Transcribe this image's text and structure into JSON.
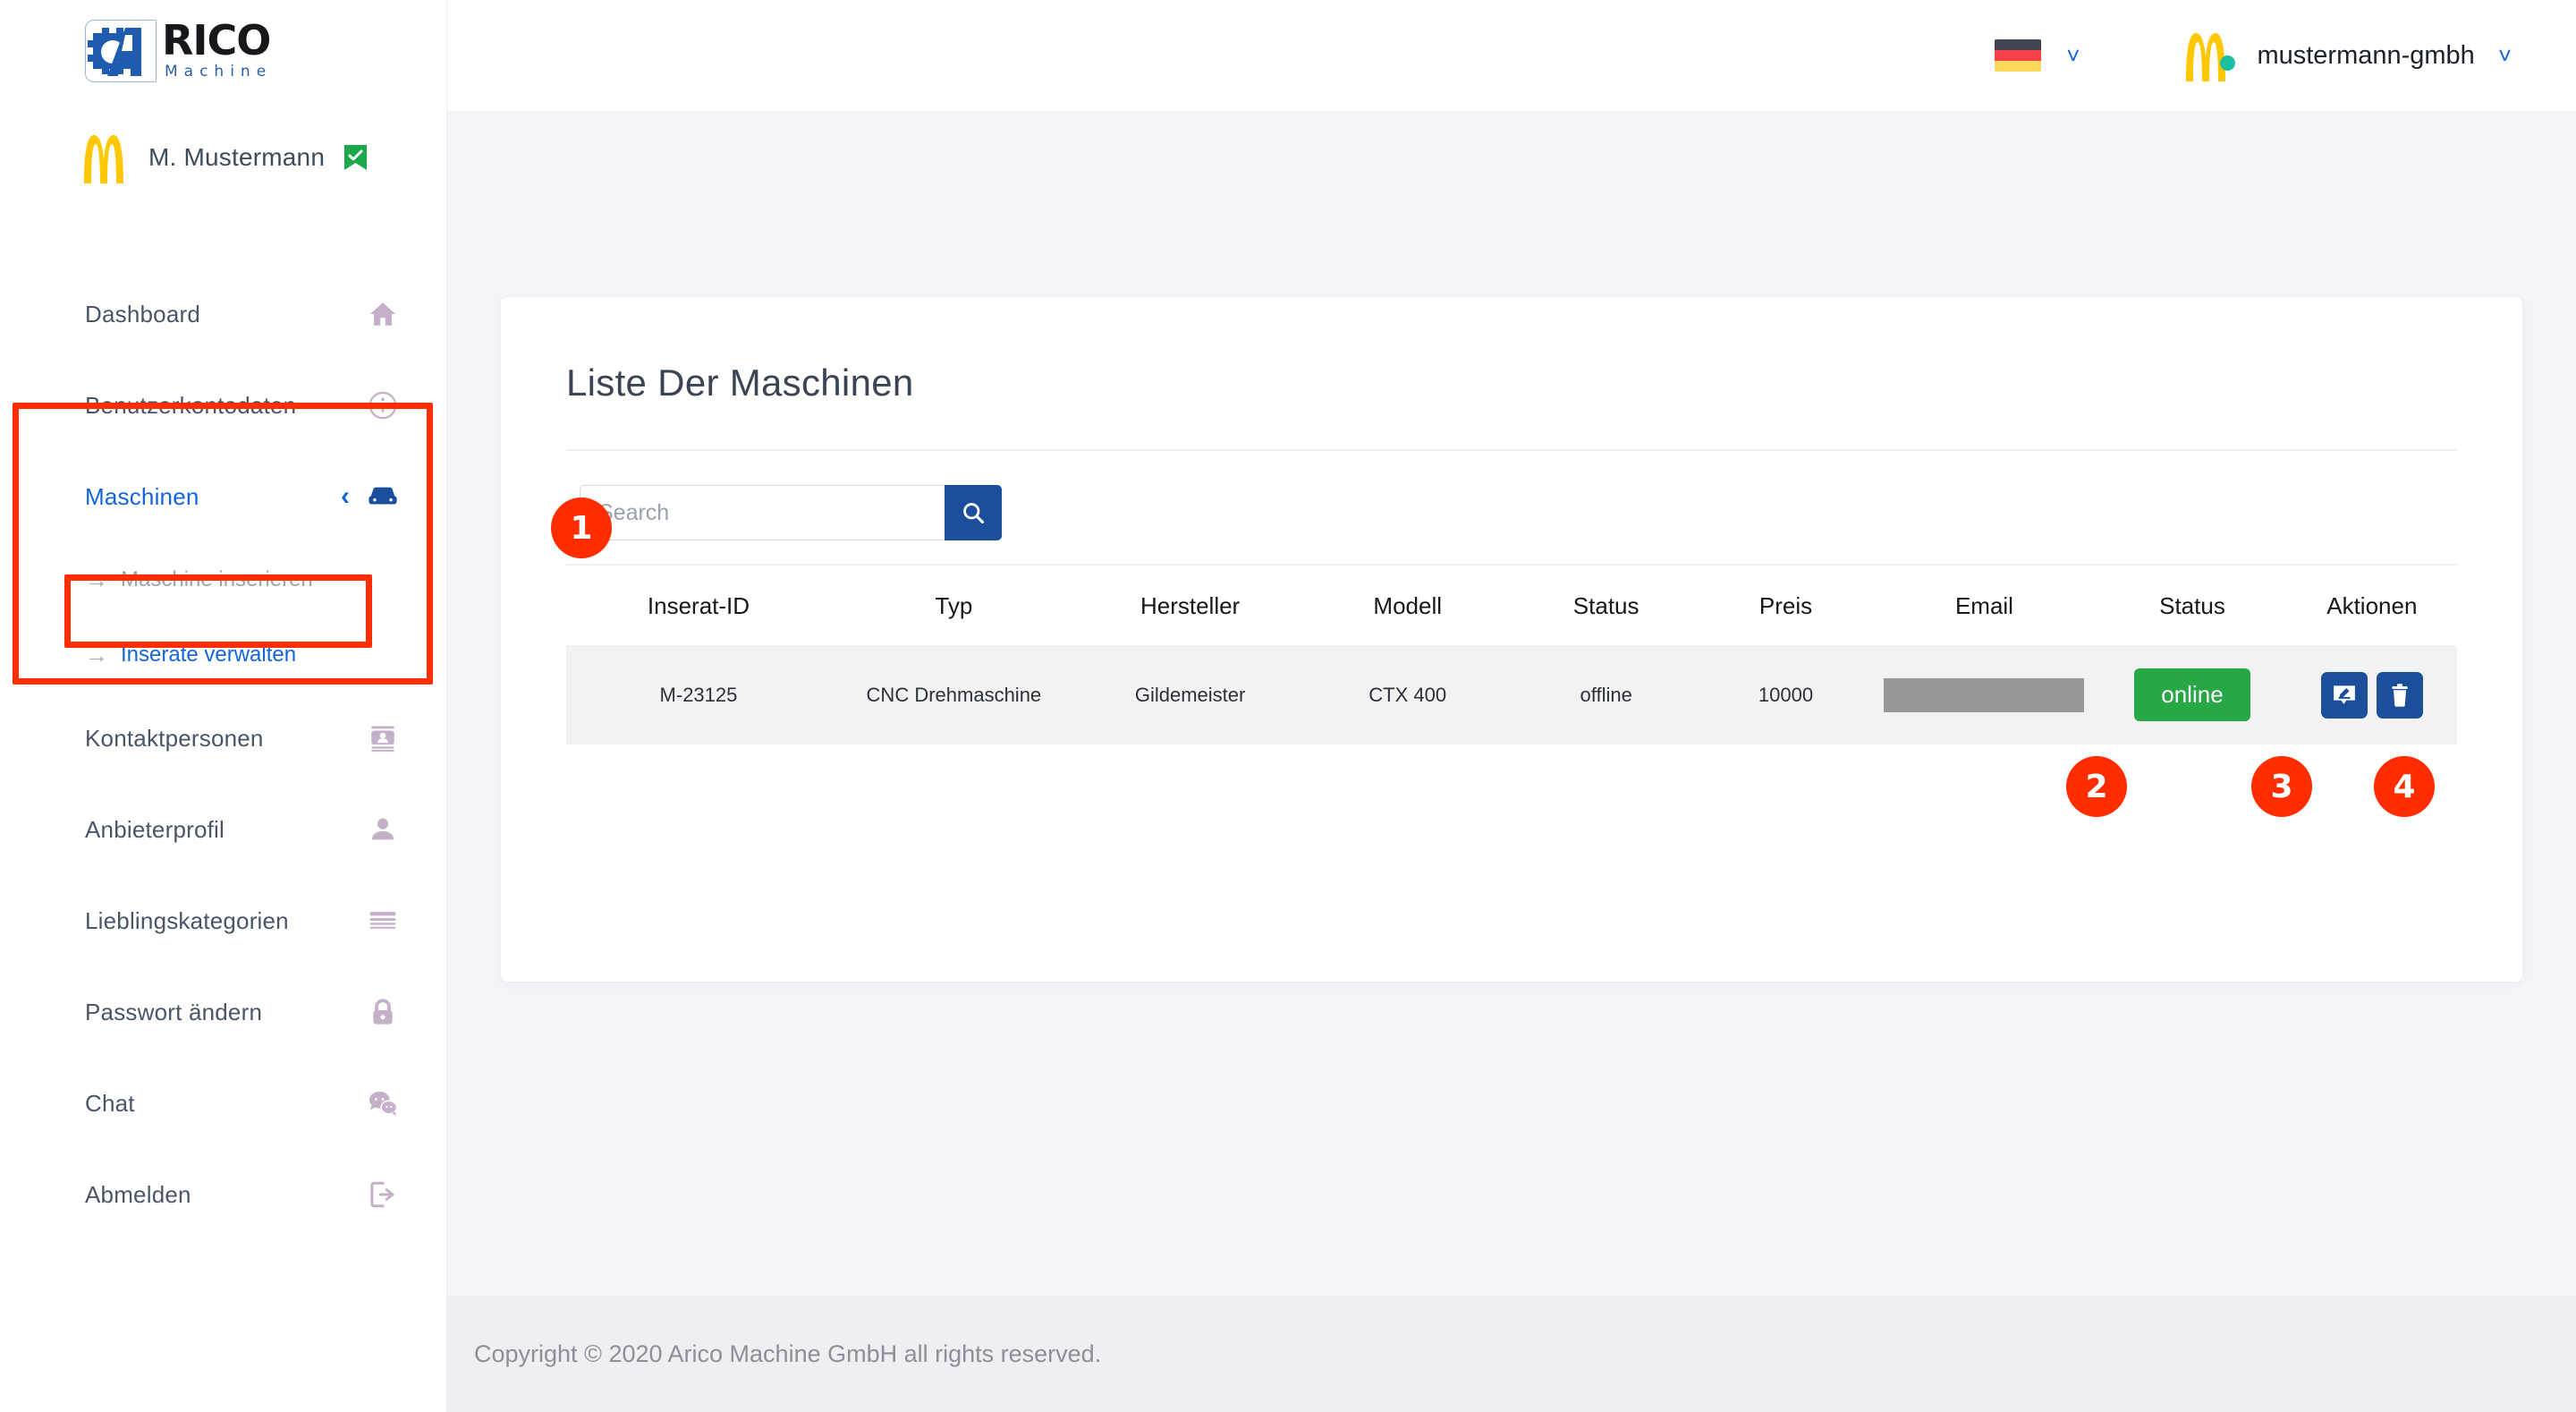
{
  "brand": {
    "logo_primary": "RICO",
    "logo_secondary": "Machine",
    "logo_blue": "#2a5fa8"
  },
  "sidebar": {
    "user": {
      "name": "M. Mustermann",
      "verified_icon": "verified-check-icon"
    },
    "items": [
      {
        "label": "Dashboard",
        "icon": "home-icon",
        "active": false
      },
      {
        "label": "Benutzerkontodaten",
        "icon": "info-circle-icon",
        "active": false
      },
      {
        "label": "Maschinen",
        "icon": "machine-car-icon",
        "active": true,
        "expanded": true
      },
      {
        "label": "Kontaktpersonen",
        "icon": "contact-card-icon",
        "active": false
      },
      {
        "label": "Anbieterprofil",
        "icon": "person-icon",
        "active": false
      },
      {
        "label": "Lieblingskategorien",
        "icon": "list-lines-icon",
        "active": false
      },
      {
        "label": "Passwort ändern",
        "icon": "lock-icon",
        "active": false
      },
      {
        "label": "Chat",
        "icon": "chat-bubbles-icon",
        "active": false
      },
      {
        "label": "Abmelden",
        "icon": "logout-icon",
        "active": false
      }
    ],
    "submenu": [
      {
        "label": "Maschine inserieren",
        "active": false
      },
      {
        "label": "Inserate verwalten",
        "active": true
      }
    ]
  },
  "topbar": {
    "language": {
      "flag": "de-flag-icon",
      "caret": "chevron-down-icon"
    },
    "account": {
      "name": "mustermann-gmbh",
      "caret": "chevron-down-icon",
      "status_dot_color": "#1dbfa3"
    }
  },
  "main": {
    "card_title": "Liste Der Maschinen",
    "search": {
      "placeholder": "Search",
      "value": "",
      "button_icon": "search-icon"
    },
    "table": {
      "headers": [
        "Inserat-ID",
        "Typ",
        "Hersteller",
        "Modell",
        "Status",
        "Preis",
        "Email",
        "Status",
        "Aktionen"
      ],
      "rows": [
        {
          "inserat_id": "M-23125",
          "typ": "CNC Drehmaschine",
          "hersteller": "Gildemeister",
          "modell": "CTX 400",
          "status": "offline",
          "preis": "10000",
          "email": "",
          "status_pill": "online",
          "status_pill_color": "#28a745",
          "actions": [
            "edit-icon",
            "delete-icon"
          ]
        }
      ]
    }
  },
  "footer": {
    "text": "Copyright © 2020  Arico Machine GmbH all rights reserved."
  },
  "markers": [
    {
      "number": "1"
    },
    {
      "number": "2"
    },
    {
      "number": "3"
    },
    {
      "number": "4"
    }
  ]
}
